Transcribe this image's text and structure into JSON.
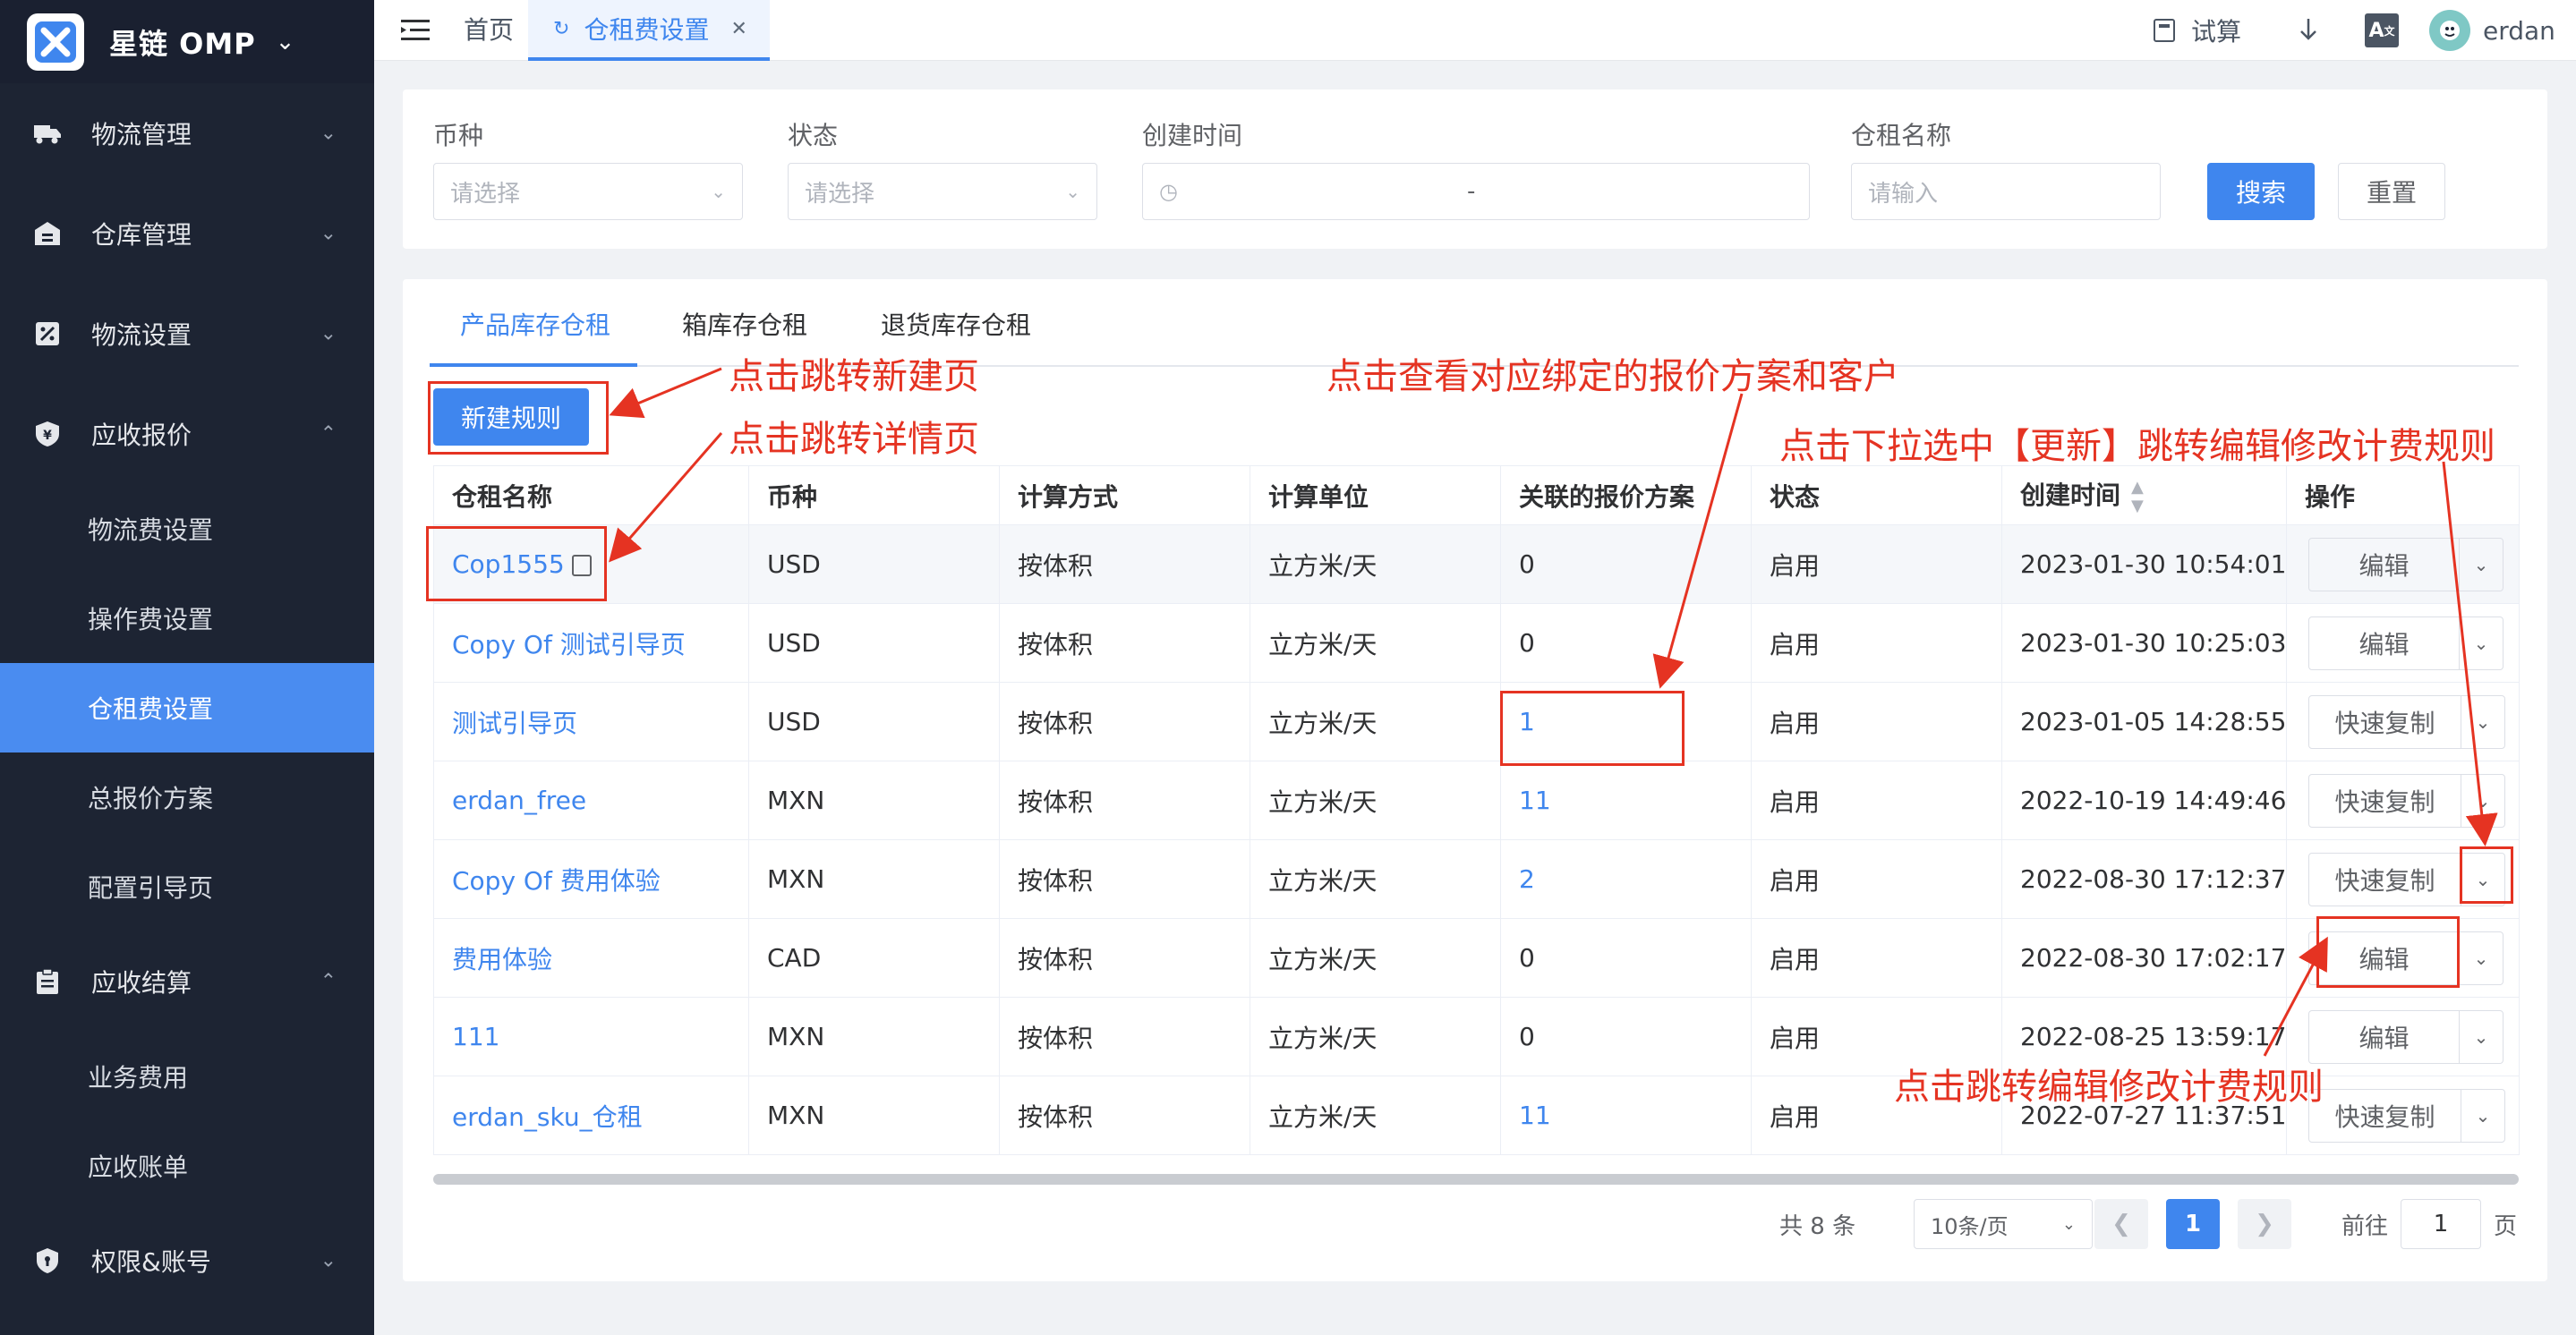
{
  "app": {
    "name": "星链 OMP"
  },
  "sidebar": {
    "groups": [
      {
        "label": "物流管理",
        "icon": "truck-icon",
        "expanded": false
      },
      {
        "label": "仓库管理",
        "icon": "warehouse-icon",
        "expanded": false
      },
      {
        "label": "物流设置",
        "icon": "settings-icon",
        "expanded": false
      },
      {
        "label": "应收报价",
        "icon": "yen-icon",
        "expanded": true,
        "items": [
          "物流费设置",
          "操作费设置",
          "仓租费设置",
          "总报价方案",
          "配置引导页"
        ]
      },
      {
        "label": "应收结算",
        "icon": "clipboard-icon",
        "expanded": true,
        "items": [
          "业务费用",
          "应收账单"
        ]
      },
      {
        "label": "权限&账号",
        "icon": "shield-icon",
        "expanded": false
      }
    ],
    "active_item": "仓租费设置"
  },
  "topbar": {
    "tabs": [
      "首页",
      "仓租费设置"
    ],
    "active_tab": "仓租费设置",
    "trial_label": "试算",
    "translate_label": "A",
    "user": "erdan"
  },
  "filters": {
    "currency": {
      "label": "币种",
      "placeholder": "请选择"
    },
    "status": {
      "label": "状态",
      "placeholder": "请选择"
    },
    "created": {
      "label": "创建时间",
      "separator": "-"
    },
    "name": {
      "label": "仓租名称",
      "placeholder": "请输入"
    },
    "search_label": "搜索",
    "reset_label": "重置"
  },
  "content_tabs": [
    "产品库存仓租",
    "箱库存仓租",
    "退货库存仓租"
  ],
  "new_rule_label": "新建规则",
  "table": {
    "columns": [
      "仓租名称",
      "币种",
      "计算方式",
      "计算单位",
      "关联的报价方案",
      "状态",
      "创建时间",
      "操作"
    ],
    "rows": [
      {
        "name": "Cop1555",
        "currency": "USD",
        "method": "按体积",
        "unit": "立方米/天",
        "plans": "0",
        "status": "启用",
        "created": "2023-01-30 10:54:01",
        "action": "编辑"
      },
      {
        "name": "Copy Of 测试引导页",
        "currency": "USD",
        "method": "按体积",
        "unit": "立方米/天",
        "plans": "0",
        "status": "启用",
        "created": "2023-01-30 10:25:03",
        "action": "编辑"
      },
      {
        "name": "测试引导页",
        "currency": "USD",
        "method": "按体积",
        "unit": "立方米/天",
        "plans": "1",
        "status": "启用",
        "created": "2023-01-05 14:28:55",
        "action": "快速复制"
      },
      {
        "name": "erdan_free",
        "currency": "MXN",
        "method": "按体积",
        "unit": "立方米/天",
        "plans": "11",
        "status": "启用",
        "created": "2022-10-19 14:49:46",
        "action": "快速复制"
      },
      {
        "name": "Copy Of 费用体验",
        "currency": "MXN",
        "method": "按体积",
        "unit": "立方米/天",
        "plans": "2",
        "status": "启用",
        "created": "2022-08-30 17:12:37",
        "action": "快速复制"
      },
      {
        "name": "费用体验",
        "currency": "CAD",
        "method": "按体积",
        "unit": "立方米/天",
        "plans": "0",
        "status": "启用",
        "created": "2022-08-30 17:02:17",
        "action": "编辑"
      },
      {
        "name": "111",
        "currency": "MXN",
        "method": "按体积",
        "unit": "立方米/天",
        "plans": "0",
        "status": "启用",
        "created": "2022-08-25 13:59:17",
        "action": "编辑"
      },
      {
        "name": "erdan_sku_仓租",
        "currency": "MXN",
        "method": "按体积",
        "unit": "立方米/天",
        "plans": "11",
        "status": "启用",
        "created": "2022-07-27 11:37:51",
        "action": "快速复制"
      }
    ]
  },
  "pagination": {
    "total_text": "共 8 条",
    "page_size": "10条/页",
    "current_page": "1",
    "goto_label": "前往",
    "goto_value": "1",
    "page_suffix": "页"
  },
  "annotations": {
    "new_page": "点击跳转新建页",
    "detail_page": "点击跳转详情页",
    "view_plans": "点击查看对应绑定的报价方案和客户",
    "dropdown_update": "点击下拉选中【更新】跳转编辑修改计费规则",
    "edit_rule": "点击跳转编辑修改计费规则"
  },
  "colors": {
    "accent": "#3f86ee",
    "sidebar": "#1d2433",
    "annotation": "#e53322"
  }
}
